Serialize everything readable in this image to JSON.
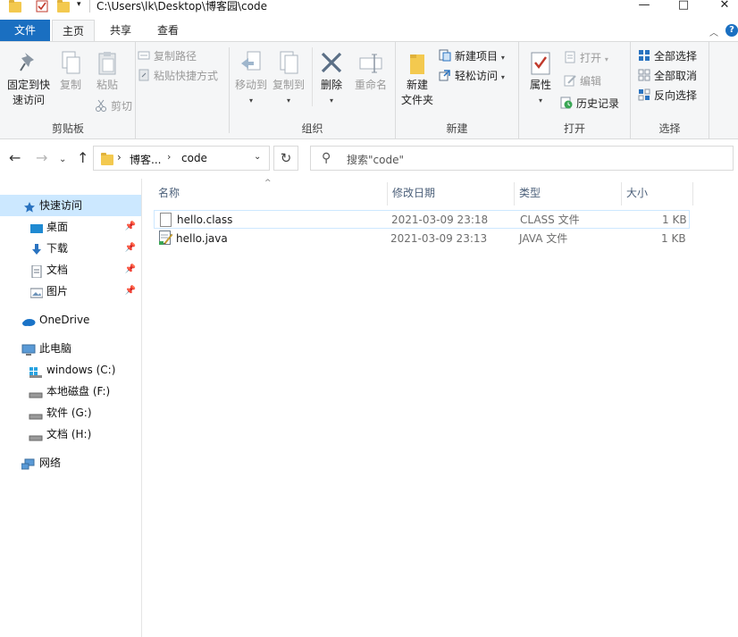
{
  "window": {
    "title": "C:\\Users\\lk\\Desktop\\博客园\\code",
    "controls": [
      "—",
      "□",
      "✕"
    ]
  },
  "tabs": [
    {
      "label": "文件"
    },
    {
      "label": "主页"
    },
    {
      "label": "共享"
    },
    {
      "label": "查看"
    }
  ],
  "help_label": "?",
  "ribbon": {
    "clipboard": {
      "group_label": "剪贴板",
      "pin_label_1": "固定到快",
      "pin_label_2": "速访问",
      "copy_label": "复制",
      "paste_label": "粘贴",
      "copy_path_label": "复制路径",
      "paste_shortcut_label": "粘贴快捷方式",
      "cut_label": "剪切"
    },
    "organize": {
      "group_label": "组织",
      "move_to_label": "移动到",
      "copy_to_label": "复制到",
      "delete_label": "删除",
      "rename_label": "重命名"
    },
    "new": {
      "group_label": "新建",
      "new_folder_label_1": "新建",
      "new_folder_label_2": "文件夹",
      "new_item_label": "新建项目",
      "easy_access_label": "轻松访问"
    },
    "open": {
      "group_label": "打开",
      "properties_label": "属性",
      "open_label": "打开",
      "edit_label": "编辑",
      "history_label": "历史记录"
    },
    "select": {
      "group_label": "选择",
      "select_all_label": "全部选择",
      "select_none_label": "全部取消",
      "invert_label": "反向选择"
    }
  },
  "address": {
    "segments": [
      "博客...",
      "code"
    ],
    "search_placeholder": "搜索\"code\""
  },
  "nav": {
    "quick_access": "快速访问",
    "quick_items": [
      {
        "label": "桌面",
        "icon": "desktop-icon"
      },
      {
        "label": "下载",
        "icon": "download-icon"
      },
      {
        "label": "文档",
        "icon": "documents-icon"
      },
      {
        "label": "图片",
        "icon": "pictures-icon"
      }
    ],
    "onedrive": "OneDrive",
    "this_pc": "此电脑",
    "drives": [
      {
        "label": "windows (C:)"
      },
      {
        "label": "本地磁盘 (F:)"
      },
      {
        "label": "软件 (G:)"
      },
      {
        "label": "文档 (H:)"
      }
    ],
    "network": "网络"
  },
  "columns": {
    "name": "名称",
    "modified": "修改日期",
    "type": "类型",
    "size": "大小"
  },
  "files": [
    {
      "name": "hello.class",
      "modified": "2021-03-09 23:18",
      "type": "CLASS 文件",
      "size": "1 KB",
      "icon": "class-file-icon"
    },
    {
      "name": "hello.java",
      "modified": "2021-03-09 23:13",
      "type": "JAVA 文件",
      "size": "1 KB",
      "icon": "java-file-icon"
    }
  ]
}
